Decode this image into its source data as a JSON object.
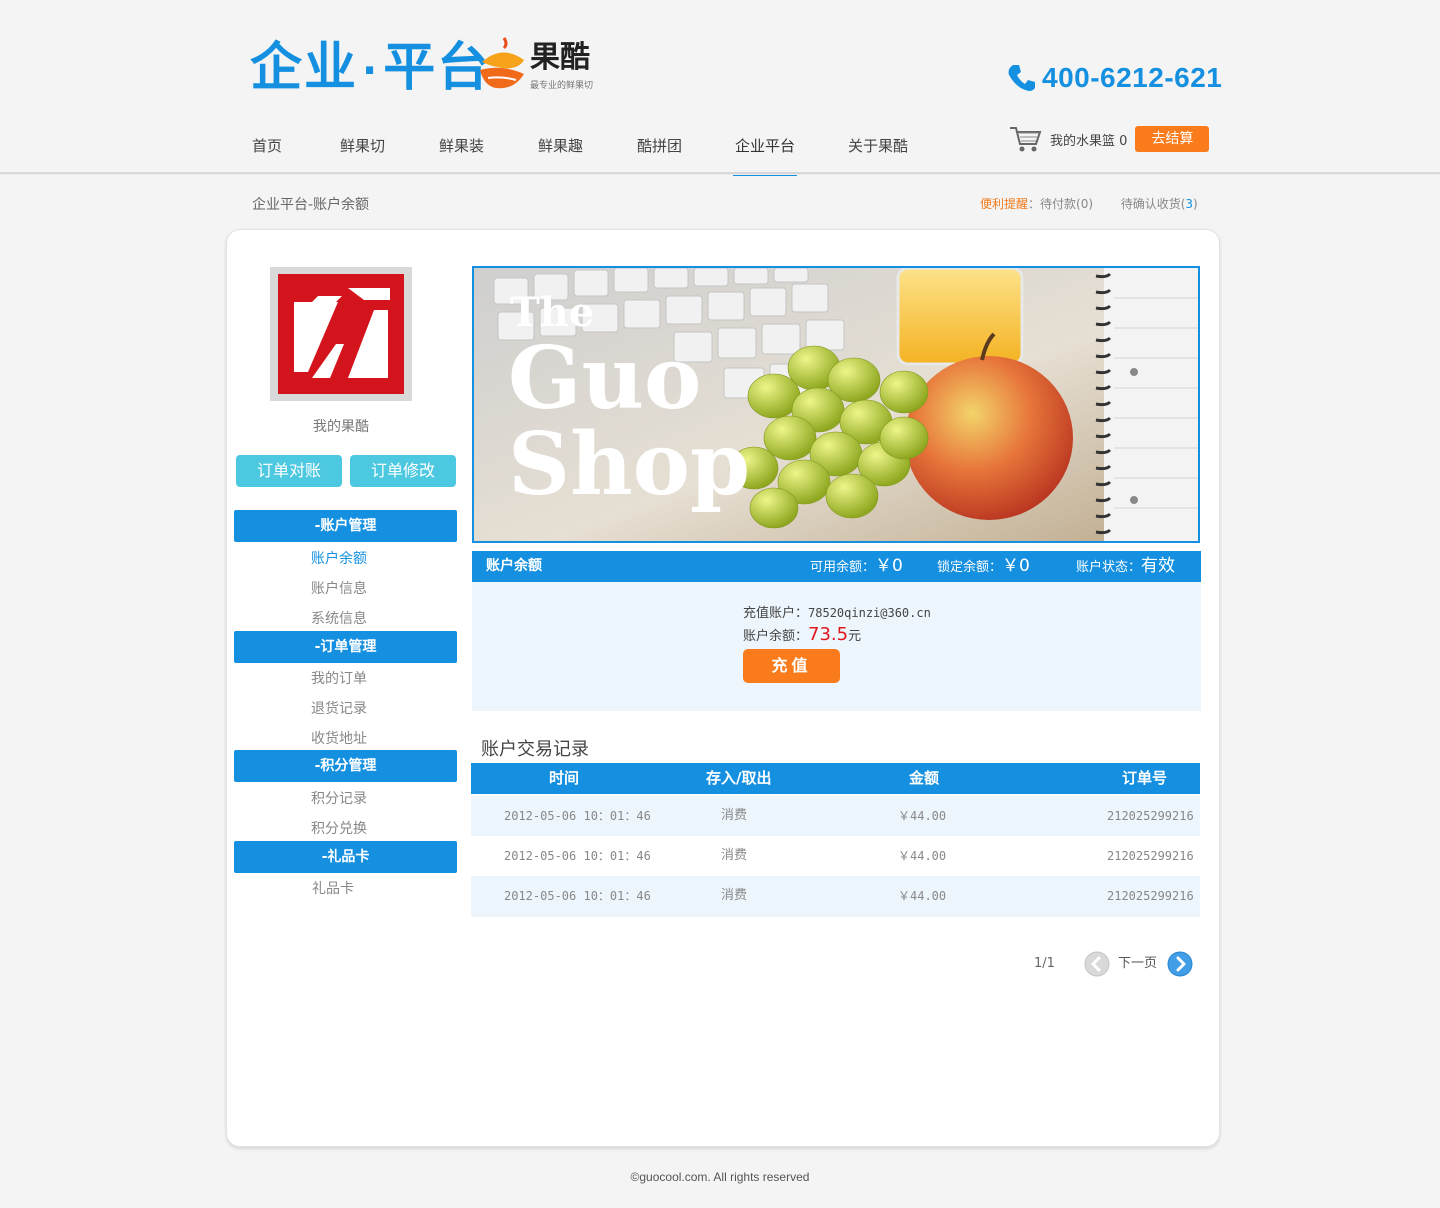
{
  "header": {
    "brand_title": "企业",
    "brand_title_2": "平台",
    "brand_dot": "·",
    "logo_name": "果酷",
    "logo_slogan": "最专业的鲜果切",
    "phone": "400-6212-621",
    "nav": [
      {
        "label": "首页"
      },
      {
        "label": "鲜果切"
      },
      {
        "label": "鲜果装"
      },
      {
        "label": "鲜果趣"
      },
      {
        "label": "酷拼团"
      },
      {
        "label": "企业平台",
        "active": true
      },
      {
        "label": "关于果酷"
      }
    ],
    "cart_label": "我的水果篮",
    "cart_count": "0",
    "checkout_label": "去结算"
  },
  "breadcrumb": "企业平台-账户余额",
  "reminder": {
    "label": "便利提醒",
    "sep": "：",
    "pending_payment": "待付款(0)",
    "pending_receipt_prefix": "待确认收货(",
    "pending_receipt_count": "3",
    "pending_receipt_suffix": ")"
  },
  "sidebar": {
    "my_label": "我的果酷",
    "btn_reconcile": "订单对账",
    "btn_modify": "订单修改",
    "sections": [
      {
        "title": "-账户管理",
        "items": [
          "账户余额",
          "账户信息",
          "系统信息"
        ]
      },
      {
        "title": "-订单管理",
        "items": [
          "我的订单",
          "退货记录",
          "收货地址"
        ]
      },
      {
        "title": "-积分管理",
        "items": [
          "积分记录",
          "积分兑换"
        ]
      },
      {
        "title": "-礼品卡",
        "items": [
          "礼品卡"
        ]
      }
    ]
  },
  "banner": {
    "line1": "The",
    "line2": "Guo",
    "line3": "Shop"
  },
  "balance": {
    "title": "账户余额",
    "available_label": "可用余额：",
    "available_value": "￥0",
    "locked_label": "锁定余额：",
    "locked_value": "￥0",
    "status_label": "账户状态：",
    "status_value": "有效",
    "account_label": "充值账户：",
    "account_value": "78520qinzi@360.cn",
    "amount_label": "账户余额：",
    "amount_value": "73.5",
    "amount_unit": "元",
    "recharge_label": "充值"
  },
  "transactions": {
    "title": "账户交易记录",
    "columns": [
      "时间",
      "存入/取出",
      "金额",
      "订单号"
    ],
    "rows": [
      [
        "2012-05-06 10：01：46",
        "消费",
        "￥44.00",
        "212025299216"
      ],
      [
        "2012-05-06 10：01：46",
        "消费",
        "￥44.00",
        "212025299216"
      ],
      [
        "2012-05-06 10：01：46",
        "消费",
        "￥44.00",
        "212025299216"
      ]
    ]
  },
  "pager": {
    "count": "1/1",
    "next_label": "下一页"
  },
  "footer": "©guocool.com. All rights reserved",
  "colors": {
    "brand_blue": "#1590e0",
    "accent_orange": "#f97b1b",
    "button_cyan": "#4cc8e0",
    "amount_red": "#e0161c"
  },
  "icons": [
    "phone-icon",
    "cart-icon",
    "prev-arrow-icon",
    "next-arrow-icon"
  ]
}
